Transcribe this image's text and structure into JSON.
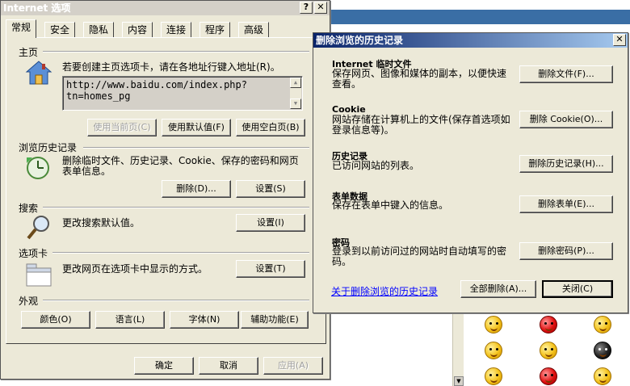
{
  "internet_options": {
    "title": "Internet 选项",
    "help_btn": "?",
    "close_btn": "✕",
    "tabs": [
      "常规",
      "安全",
      "隐私",
      "内容",
      "连接",
      "程序",
      "高级"
    ],
    "home": {
      "heading": "主页",
      "description": "若要创建主页选项卡，请在各地址行键入地址(R)。",
      "url": "http://www.baidu.com/index.php?tn=homes_pg",
      "use_current": "使用当前页(C)",
      "use_default": "使用默认值(F)",
      "use_blank": "使用空白页(B)"
    },
    "history": {
      "heading": "浏览历史记录",
      "description": "删除临时文件、历史记录、Cookie、保存的密码和网页表单信息。",
      "delete": "删除(D)...",
      "settings": "设置(S)"
    },
    "search": {
      "heading": "搜索",
      "description": "更改搜索默认值。",
      "settings": "设置(I)"
    },
    "tabs_section": {
      "heading": "选项卡",
      "description": "更改网页在选项卡中显示的方式。",
      "settings": "设置(T)"
    },
    "appearance": {
      "heading": "外观",
      "colors": "颜色(O)",
      "languages": "语言(L)",
      "fonts": "字体(N)",
      "accessibility": "辅助功能(E)"
    },
    "footer": {
      "ok": "确定",
      "cancel": "取消",
      "apply": "应用(A)"
    }
  },
  "delete_history": {
    "title": "删除浏览的历史记录",
    "close_btn": "✕",
    "sections": [
      {
        "title": "Internet 临时文件",
        "desc": "保存网页、图像和媒体的副本，以便快速查看。",
        "button": "删除文件(F)..."
      },
      {
        "title": "Cookie",
        "desc": "网站存储在计算机上的文件(保存首选项如登录信息等)。",
        "button": "删除 Cookie(O)..."
      },
      {
        "title": "历史记录",
        "desc": "已访问网站的列表。",
        "button": "删除历史记录(H)..."
      },
      {
        "title": "表单数据",
        "desc": "保存在表单中键入的信息。",
        "button": "删除表单(E)..."
      },
      {
        "title": "密码",
        "desc": "登录到以前访问过的网站时自动填写的密码。",
        "button": "删除密码(P)..."
      }
    ],
    "about_link": "关于删除浏览的历史记录",
    "delete_all": "全部删除(A)...",
    "close": "关闭(C)"
  }
}
